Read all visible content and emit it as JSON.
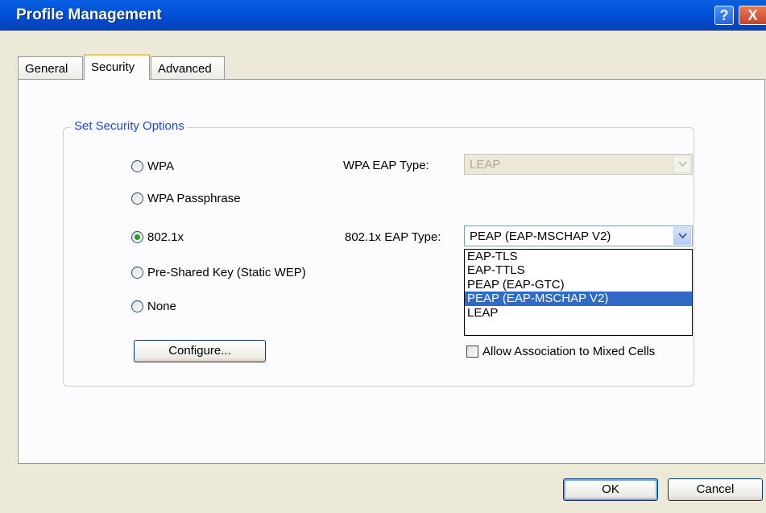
{
  "window": {
    "title": "Profile Management",
    "help_label": "?",
    "close_label": "X"
  },
  "tabs": [
    {
      "label": "General"
    },
    {
      "label": "Security",
      "active": true
    },
    {
      "label": "Advanced"
    }
  ],
  "security": {
    "group_title": "Set Security Options",
    "options": [
      {
        "label": "WPA",
        "selected": false
      },
      {
        "label": "WPA Passphrase",
        "selected": false
      },
      {
        "label": "802.1x",
        "selected": true
      },
      {
        "label": "Pre-Shared Key (Static WEP)",
        "selected": false
      },
      {
        "label": "None",
        "selected": false
      }
    ],
    "wpa_eap_type_label": "WPA EAP Type:",
    "wpa_eap_type_value": "LEAP",
    "dot1x_eap_type_label": "802.1x EAP Type:",
    "dot1x_eap_type_value": "PEAP (EAP-MSCHAP V2)",
    "dot1x_options": [
      "EAP-TLS",
      "EAP-TTLS",
      "PEAP (EAP-GTC)",
      "PEAP (EAP-MSCHAP V2)",
      "LEAP"
    ],
    "configure_label": "Configure...",
    "mixed_cells_label": "Allow Association to Mixed Cells",
    "mixed_cells_checked": false
  },
  "footer": {
    "ok_label": "OK",
    "cancel_label": "Cancel"
  },
  "icons": {
    "dropdown_arrow": "chevron-down-icon",
    "radio": "radio-icon",
    "checkbox": "checkbox-icon"
  }
}
